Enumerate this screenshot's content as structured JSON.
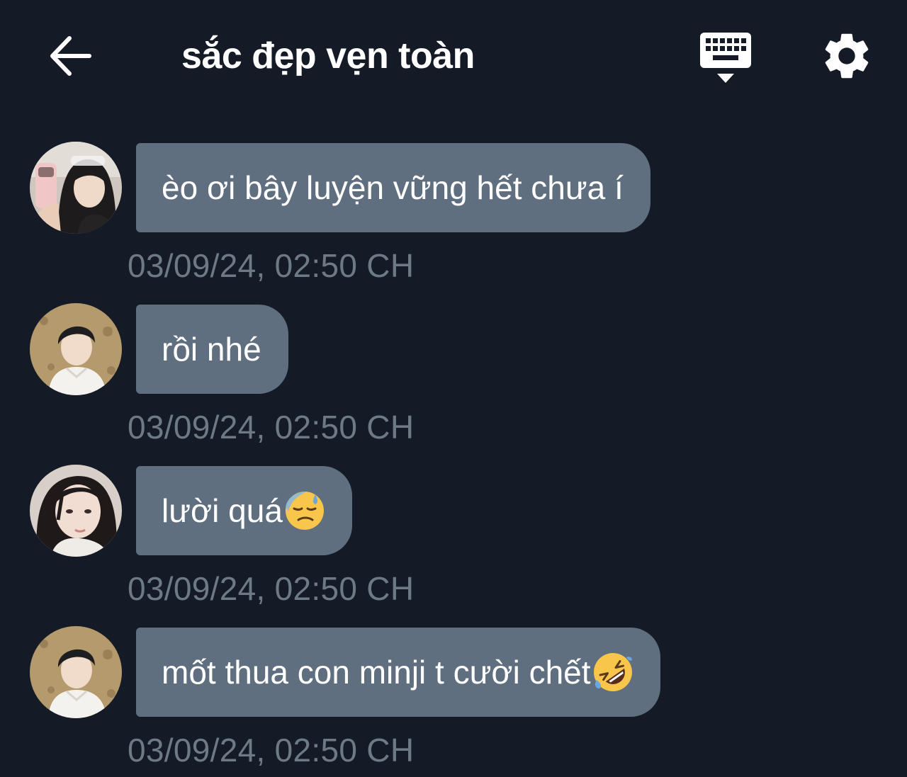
{
  "header": {
    "title": "sắc đẹp vẹn toàn",
    "back_icon": "arrow-left-icon",
    "keyboard_icon": "keyboard-hide-icon",
    "settings_icon": "gear-icon"
  },
  "theme": {
    "background": "#141b26",
    "bubble": "#5f6f80",
    "timestamp": "#6d7985",
    "text": "#ffffff"
  },
  "messages": [
    {
      "text": "èo ơi bây luyện vững hết chưa í",
      "emoji": "",
      "time": "03/09/24, 02:50 CH",
      "avatar": "avatar-girl-selfie"
    },
    {
      "text": "rồi nhé",
      "emoji": "",
      "time": "03/09/24, 02:50 CH",
      "avatar": "avatar-boy"
    },
    {
      "text": "lười quá",
      "emoji": "downcast-face-sweat-emoji",
      "time": "03/09/24, 02:50 CH",
      "avatar": "avatar-girl-closeup"
    },
    {
      "text": "mốt thua con minji t cười chết",
      "emoji": "rolling-laughing-emoji",
      "time": "03/09/24, 02:50 CH",
      "avatar": "avatar-boy"
    }
  ]
}
